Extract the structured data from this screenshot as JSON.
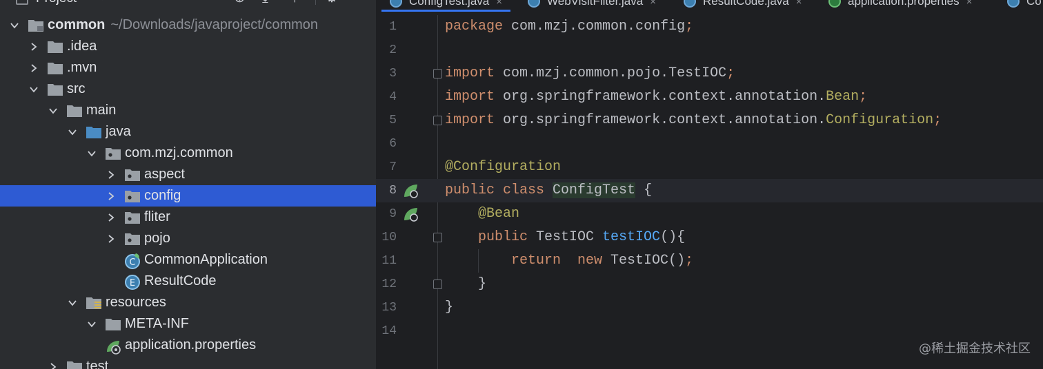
{
  "panel": {
    "title": "Project",
    "icons": [
      "project-view-icon",
      "locate-icon",
      "expand-all-icon",
      "collapse-all-icon",
      "settings-gear-icon"
    ]
  },
  "tree": [
    {
      "label": "common",
      "path": "~/Downloads/javaproject/common",
      "bold": true,
      "depth": 0,
      "arrow": "down",
      "icon": "module-folder"
    },
    {
      "label": ".idea",
      "depth": 1,
      "arrow": "right",
      "icon": "folder"
    },
    {
      "label": ".mvn",
      "depth": 1,
      "arrow": "right",
      "icon": "folder"
    },
    {
      "label": "src",
      "depth": 1,
      "arrow": "down",
      "icon": "folder"
    },
    {
      "label": "main",
      "depth": 2,
      "arrow": "down",
      "icon": "folder"
    },
    {
      "label": "java",
      "depth": 3,
      "arrow": "down",
      "icon": "source-folder"
    },
    {
      "label": "com.mzj.common",
      "depth": 4,
      "arrow": "down",
      "icon": "package"
    },
    {
      "label": "aspect",
      "depth": 5,
      "arrow": "right",
      "icon": "package"
    },
    {
      "label": "config",
      "depth": 5,
      "arrow": "right",
      "icon": "package",
      "selected": true
    },
    {
      "label": "fliter",
      "depth": 5,
      "arrow": "right",
      "icon": "package"
    },
    {
      "label": "pojo",
      "depth": 5,
      "arrow": "right",
      "icon": "package"
    },
    {
      "label": "CommonApplication",
      "depth": 5,
      "arrow": "none",
      "icon": "spring-class"
    },
    {
      "label": "ResultCode",
      "depth": 5,
      "arrow": "none",
      "icon": "enum"
    },
    {
      "label": "resources",
      "depth": 3,
      "arrow": "down",
      "icon": "resources-folder"
    },
    {
      "label": "META-INF",
      "depth": 4,
      "arrow": "down",
      "icon": "folder"
    },
    {
      "label": "application.properties",
      "depth": 4,
      "arrow": "none",
      "icon": "spring-properties"
    },
    {
      "label": "test",
      "depth": 2,
      "arrow": "right",
      "icon": "folder"
    }
  ],
  "tabs": [
    {
      "label": "ConfigTest.java",
      "icon": "class",
      "active": true
    },
    {
      "label": "WebVisitFilter.java",
      "icon": "class"
    },
    {
      "label": "ResultCode.java",
      "icon": "class"
    },
    {
      "label": "application.properties",
      "icon": "properties"
    },
    {
      "label": "Co",
      "icon": "class"
    }
  ],
  "editor": {
    "current_line": 8,
    "lines": [
      {
        "n": "1",
        "tokens": [
          [
            "kw",
            "package"
          ],
          [
            "",
            "com.mzj.common.config"
          ],
          [
            "kw",
            ";"
          ]
        ]
      },
      {
        "n": "2",
        "tokens": []
      },
      {
        "n": "3",
        "fold": true,
        "tokens": [
          [
            "kw",
            "import"
          ],
          [
            "",
            "com.mzj.common.pojo.TestIOC"
          ],
          [
            "kw",
            ";"
          ]
        ]
      },
      {
        "n": "4",
        "tokens": [
          [
            "kw",
            "import"
          ],
          [
            "",
            "org.springframework.context.annotation."
          ],
          [
            "ann",
            "Bean"
          ],
          [
            "kw",
            ";"
          ]
        ]
      },
      {
        "n": "5",
        "fold": true,
        "tokens": [
          [
            "kw",
            "import"
          ],
          [
            "",
            "org.springframework.context.annotation."
          ],
          [
            "ann",
            "Configuration"
          ],
          [
            "kw",
            ";"
          ]
        ]
      },
      {
        "n": "6",
        "tokens": []
      },
      {
        "n": "7",
        "tokens": [
          [
            "ann",
            "@Configuration"
          ]
        ]
      },
      {
        "n": "8",
        "gutter": "spring-bean-icon",
        "tokens": [
          [
            "kw",
            "public class "
          ],
          [
            "hl",
            "ConfigTest"
          ],
          [
            "",
            " {"
          ]
        ]
      },
      {
        "n": "9",
        "gutter": "spring-bean-navigate-icon",
        "tokens": [
          [
            "",
            "    "
          ],
          [
            "ann",
            "@Bean"
          ]
        ]
      },
      {
        "n": "10",
        "fold": true,
        "tokens": [
          [
            "",
            "    "
          ],
          [
            "kw",
            "public "
          ],
          [
            "",
            "TestIOC "
          ],
          [
            "fn",
            "testIOC"
          ],
          [
            "",
            "(){"
          ]
        ]
      },
      {
        "n": "11",
        "tokens": [
          [
            "",
            "        "
          ],
          [
            "kw",
            "return  new "
          ],
          [
            "",
            "TestIOC()"
          ],
          [
            "kw",
            ";"
          ]
        ]
      },
      {
        "n": "12",
        "fold": true,
        "tokens": [
          [
            "",
            "    }"
          ]
        ]
      },
      {
        "n": "13",
        "tokens": [
          [
            "",
            "}"
          ]
        ]
      },
      {
        "n": "14",
        "tokens": []
      }
    ]
  },
  "watermark": "@稀土掘金技术社区",
  "colors": {
    "selection": "#2e5bd3",
    "keyword": "#cf8e6d",
    "annotation": "#b3ae60",
    "method": "#56a8f5"
  }
}
